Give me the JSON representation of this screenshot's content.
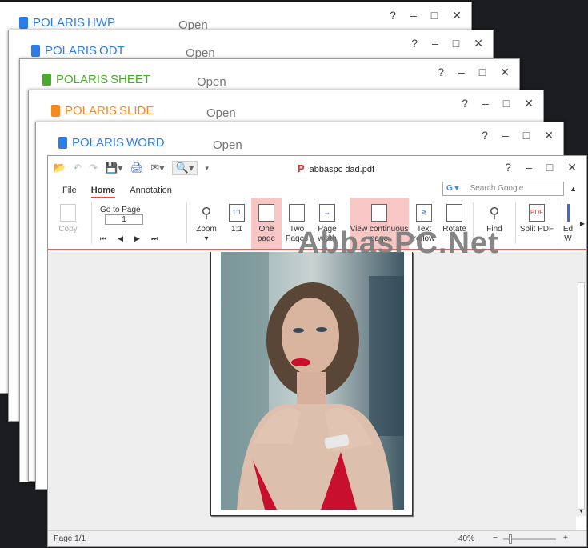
{
  "background_windows": [
    {
      "brand": "POLARIS",
      "name": "HWP",
      "color": "#2b7de9",
      "open": "Open"
    },
    {
      "brand": "POLARIS",
      "name": "ODT",
      "color": "#2b7de9",
      "open": "Open"
    },
    {
      "brand": "POLARIS",
      "name": "SHEET",
      "color": "#4aaa2a",
      "open": "Open"
    },
    {
      "brand": "POLARIS",
      "name": "SLIDE",
      "color": "#f58a1f",
      "open": "Open"
    },
    {
      "brand": "POLARIS",
      "name": "WORD",
      "color": "#2b7de9",
      "open": "Open"
    }
  ],
  "window_controls": {
    "help": "?",
    "minimize": "–",
    "maximize": "□",
    "close": "✕"
  },
  "main": {
    "title": "abbaspc dad.pdf",
    "tabs": [
      "File",
      "Home",
      "Annotation"
    ],
    "search_placeholder": "Search Google",
    "ribbon": {
      "copy": "Copy",
      "goto_label": "Go to Page",
      "goto_value": "1",
      "zoom": "Zoom",
      "one_to_one": "1:1",
      "one_page": "One page",
      "two_pages": "Two Pages",
      "page_width": "Page width",
      "view_continuous": "View continuous page",
      "text_reflow": "Text reflow",
      "rotate": "Rotate",
      "find": "Find",
      "split_pdf": "Split PDF",
      "edit": "Ed W"
    },
    "status": {
      "page": "Page 1/1",
      "zoom": "40%",
      "zoom_level_percent": 40
    }
  },
  "watermark": "AbbasPC.Net"
}
